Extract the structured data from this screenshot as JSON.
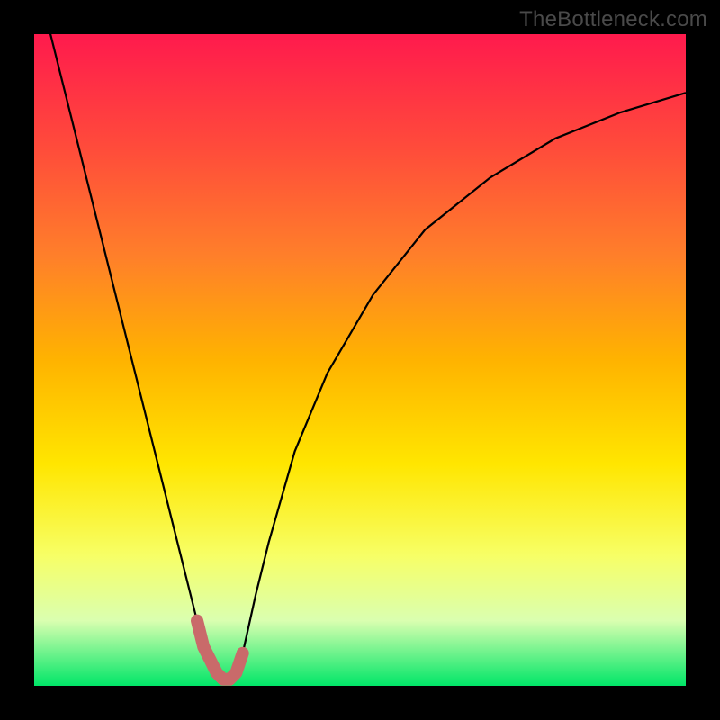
{
  "watermark": "TheBottleneck.com",
  "chart_data": {
    "type": "line",
    "title": "",
    "xlabel": "",
    "ylabel": "",
    "xlim": [
      0,
      100
    ],
    "ylim": [
      0,
      100
    ],
    "series": [
      {
        "name": "bottleneck-curve",
        "x": [
          0,
          5,
          10,
          15,
          18,
          21,
          23,
          25,
          27,
          28,
          29,
          30,
          31,
          32,
          34,
          36,
          40,
          45,
          52,
          60,
          70,
          80,
          90,
          100
        ],
        "values": [
          110,
          90,
          70,
          50,
          38,
          26,
          18,
          10,
          4,
          2,
          1,
          1,
          2,
          5,
          14,
          22,
          36,
          48,
          60,
          70,
          78,
          84,
          88,
          91
        ]
      },
      {
        "name": "optimal-band",
        "x": [
          25,
          26,
          27,
          28,
          29,
          30,
          31,
          32
        ],
        "values": [
          10,
          6,
          4,
          2,
          1,
          1,
          2,
          5
        ]
      }
    ],
    "colors": {
      "curve": "#000000",
      "optimal": "#c96a6a"
    }
  }
}
